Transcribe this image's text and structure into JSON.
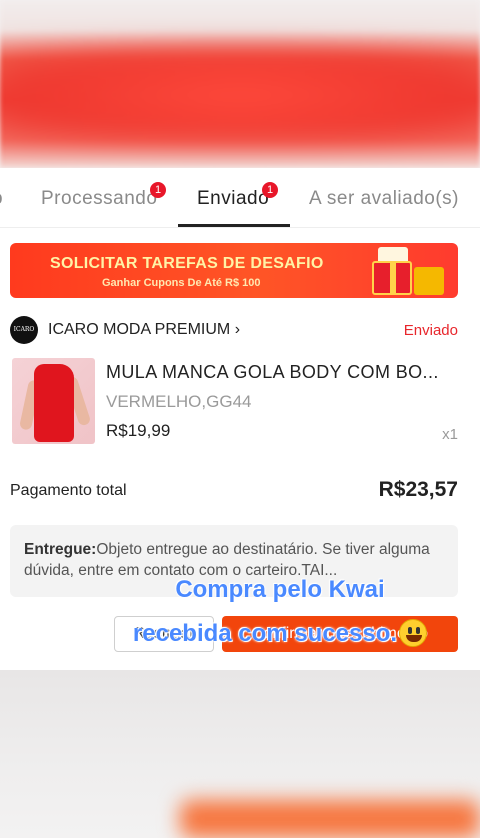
{
  "tabs": [
    {
      "label": "Processando",
      "badge": "1"
    },
    {
      "label": "Enviado",
      "badge": "1",
      "active": true
    },
    {
      "label": "A ser avaliado(s)"
    }
  ],
  "banner": {
    "title": "SOLICITAR TAREFAS DE DESAFIO",
    "subtitle": "Ganhar Cupons De Até R$ 100"
  },
  "order": {
    "shop_logo_text": "ICARO",
    "shop_name": "ICARO MODA PREMIUM",
    "shop_chevron": "›",
    "status": "Enviado",
    "product_title": "MULA MANCA  GOLA BODY  COM BO...",
    "variant": "VERMELHO,GG44",
    "price": "R$19,99",
    "qty": "x1",
    "total_label": "Pagamento total",
    "total_value": "R$23,57",
    "delivery_label": "Entregue:",
    "delivery_text": "Objeto entregue ao destinatário. Se tiver alguma dúvida, entre em contato com o carteiro.TAI..."
  },
  "actions": {
    "track": "Rastrear",
    "confirm": "Confirmar o recebimento"
  },
  "overlay": {
    "caption": "Compra pelo Kwai recebida com sucesso."
  },
  "colors": {
    "accent": "#f2450c",
    "status": "#e8262c",
    "badge": "#e8172a",
    "caption": "#4a89ff"
  }
}
